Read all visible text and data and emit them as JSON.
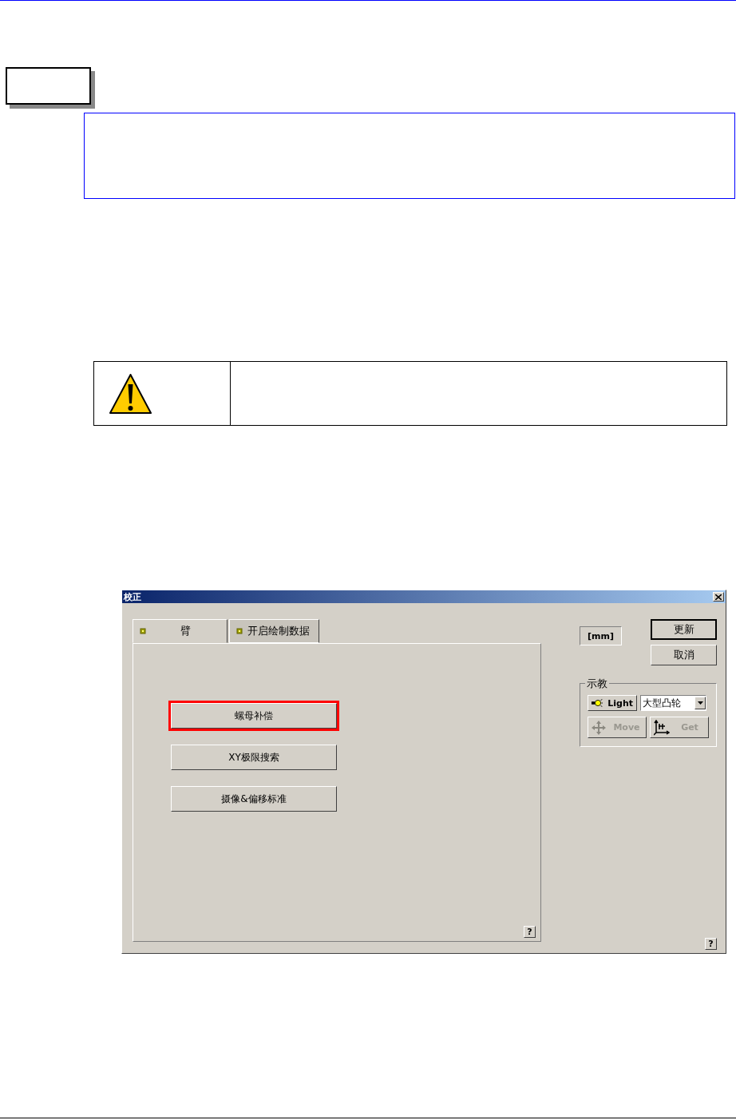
{
  "dialog": {
    "title": "校正",
    "tabs": [
      {
        "label": "臂",
        "selected": true
      },
      {
        "label": "开启绘制数据",
        "selected": false
      }
    ],
    "panel_buttons": [
      {
        "label": "螺母补偿",
        "highlighted": true
      },
      {
        "label": "XY极限搜索",
        "highlighted": false
      },
      {
        "label": "摄像&偏移标准",
        "highlighted": false
      }
    ],
    "panel_help": "?",
    "unit": "[mm]",
    "buttons": [
      {
        "label": "更新",
        "default": true
      },
      {
        "label": "取消",
        "default": false
      }
    ],
    "teach": {
      "title": "示教",
      "light": "Light",
      "select_value": "大型凸轮",
      "move": {
        "label": "Move",
        "disabled": true
      },
      "get": {
        "label": "Get",
        "disabled": true
      }
    },
    "help": "?"
  }
}
